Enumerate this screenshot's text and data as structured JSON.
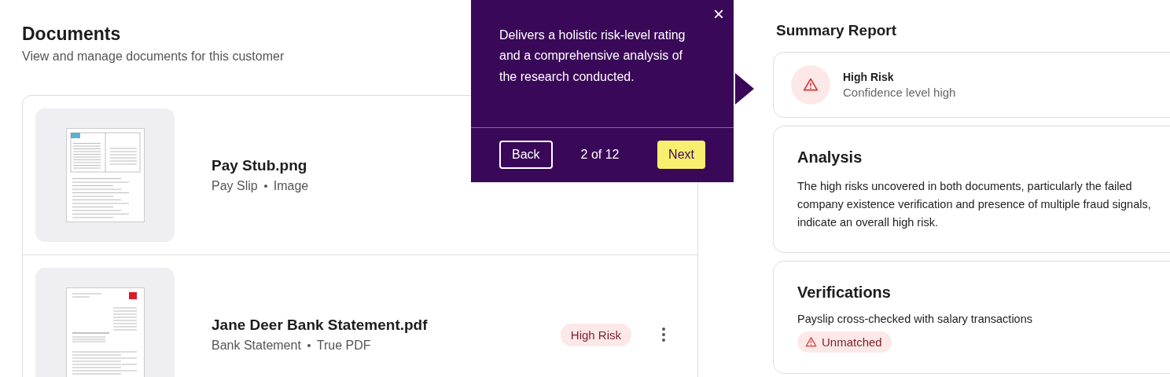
{
  "documents": {
    "title": "Documents",
    "subtitle": "View and manage documents for this customer",
    "items": [
      {
        "name": "Pay Stub.png",
        "type": "Pay Slip",
        "format": "Image",
        "kind": "payslip"
      },
      {
        "name": "Jane Deer Bank Statement.pdf",
        "type": "Bank Statement",
        "format": "True PDF",
        "kind": "statement",
        "badge": "High Risk"
      }
    ]
  },
  "tooltip": {
    "text": "Delivers a holistic risk-level rating and a comprehensive analysis of the research conducted.",
    "close": "×",
    "back": "Back",
    "progress": "2 of 12",
    "next": "Next"
  },
  "summary": {
    "title": "Summary Report",
    "risk": {
      "label": "High Risk",
      "confidence": "Confidence level high"
    },
    "analysis": {
      "title": "Analysis",
      "text": "The high risks uncovered in both documents, particularly the failed company existence verification and presence of multiple fraud signals, indicate an overall high risk."
    },
    "verifications": {
      "title": "Verifications",
      "items": [
        {
          "label": "Payslip cross-checked with salary transactions",
          "status": "Unmatched"
        }
      ]
    }
  }
}
